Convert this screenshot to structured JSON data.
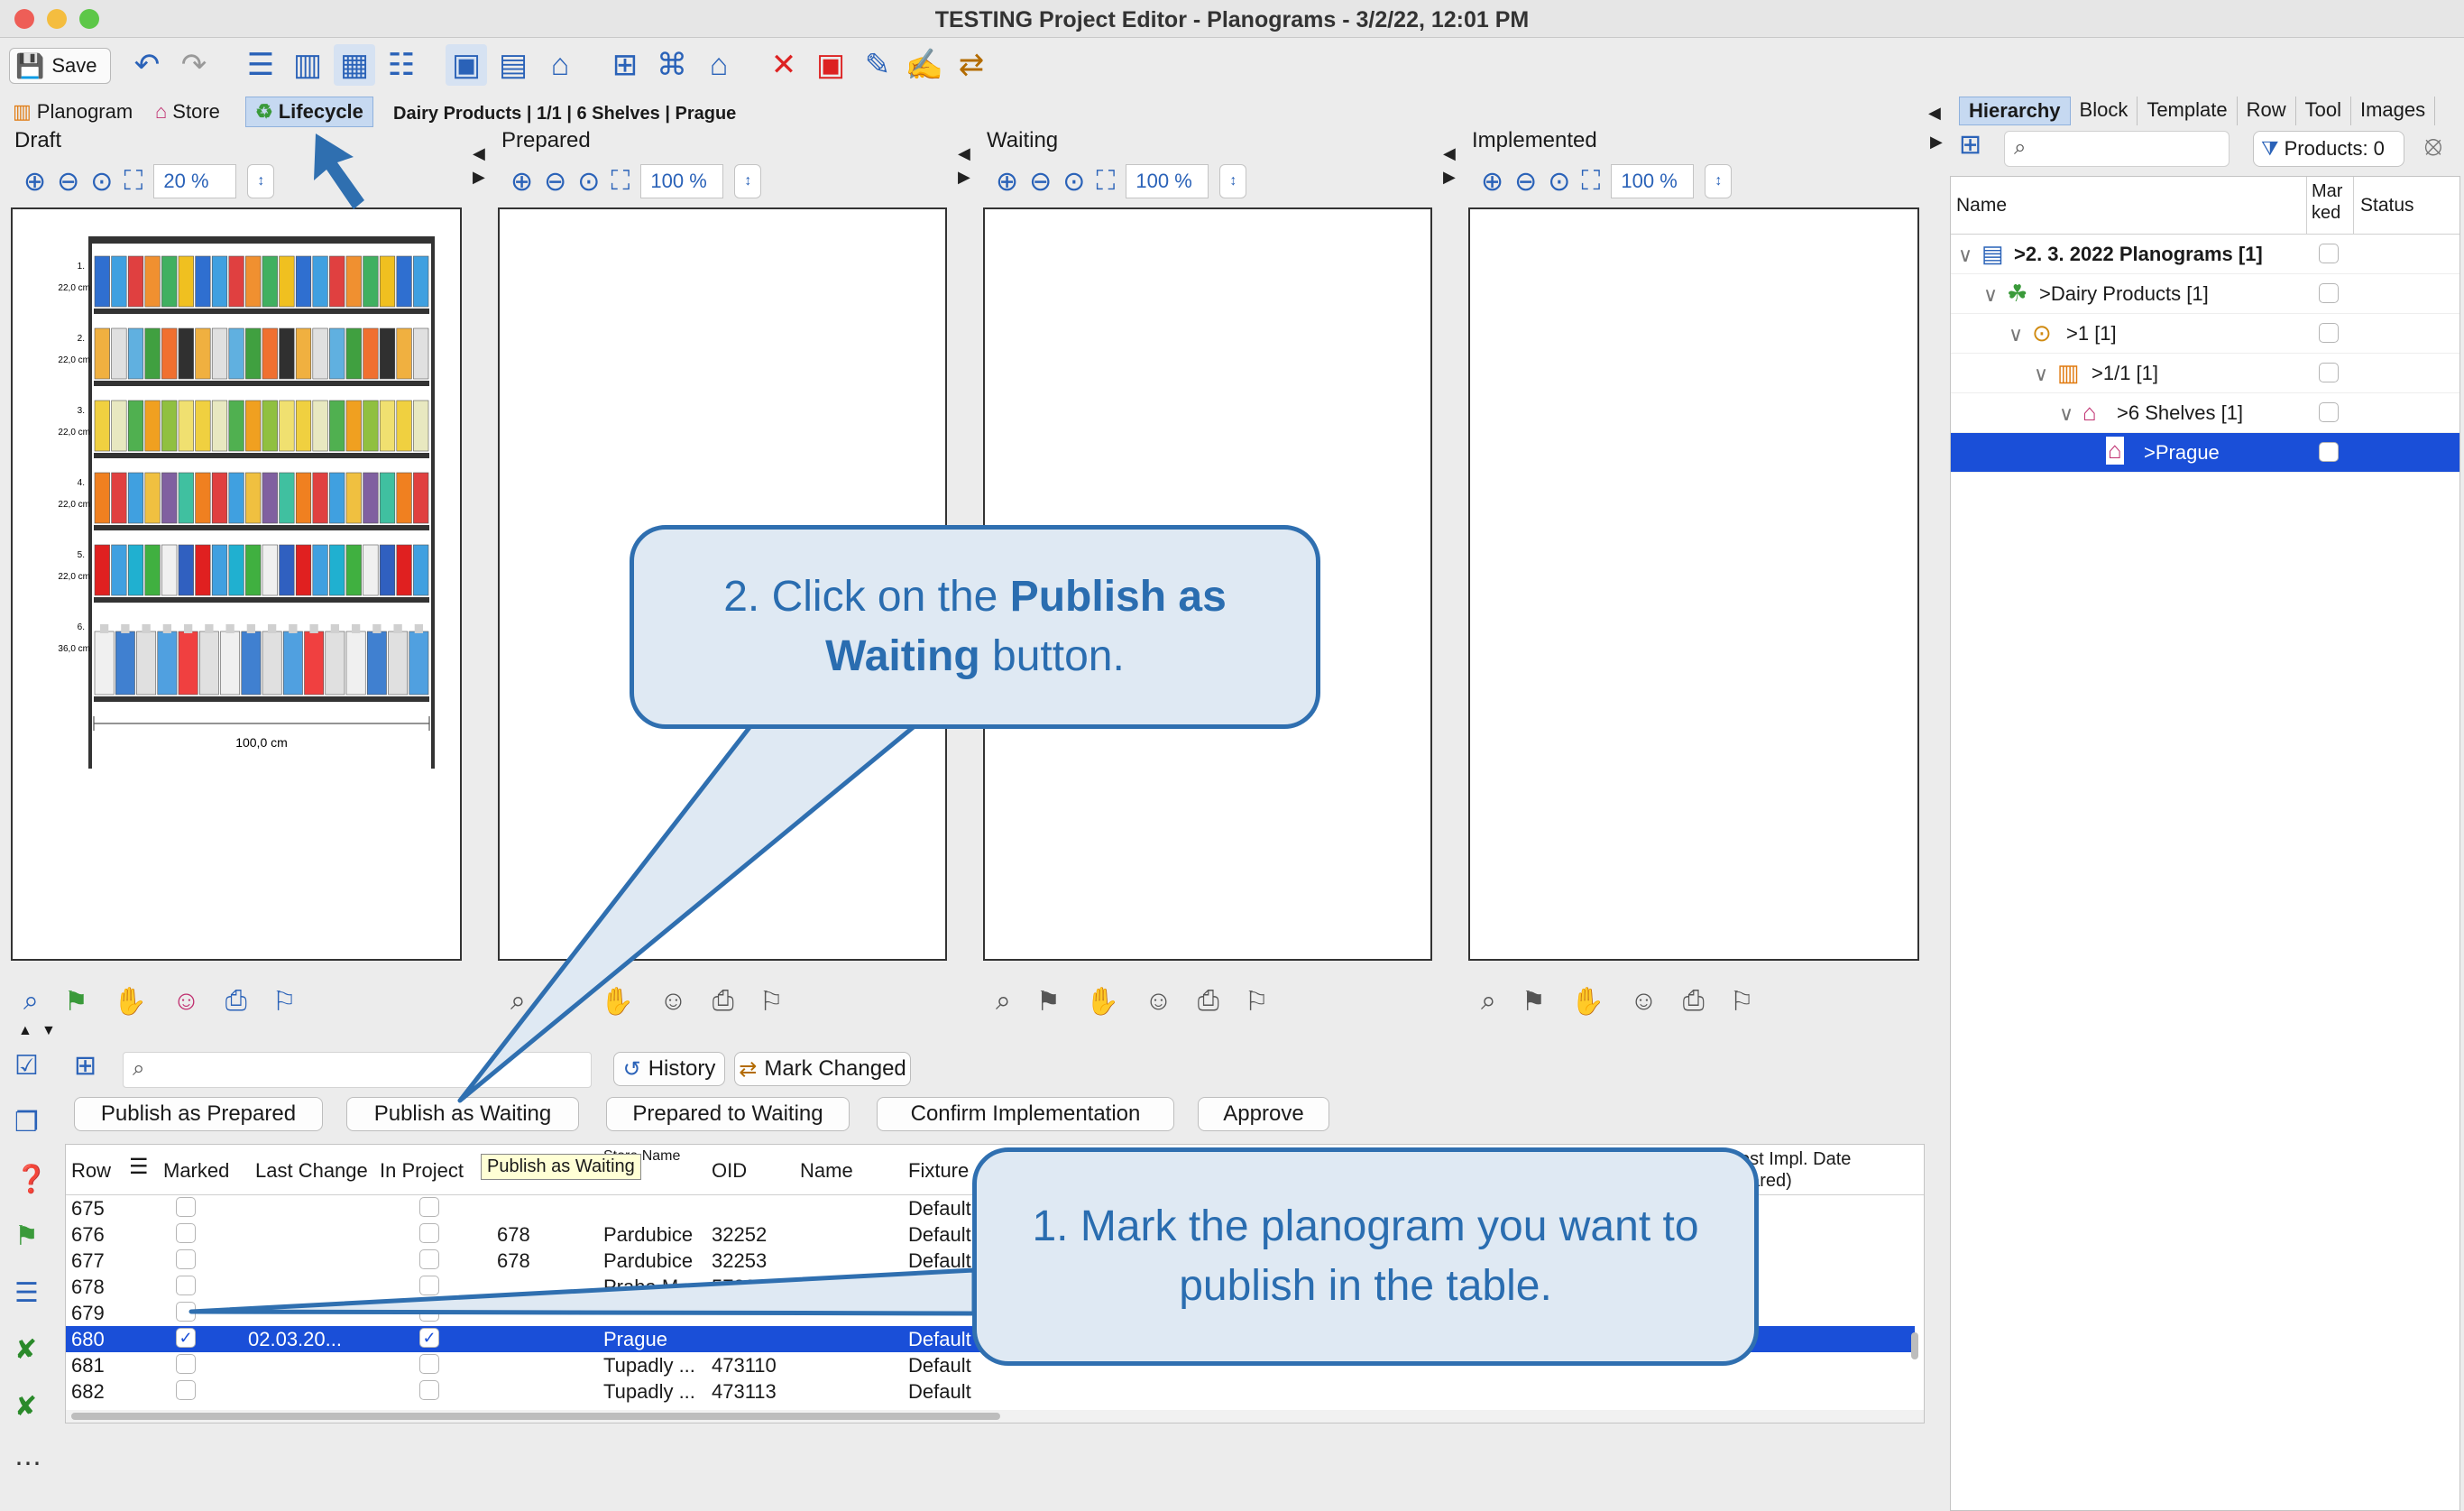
{
  "window": {
    "title": "TESTING Project Editor - Planograms - 3/2/22, 12:01 PM"
  },
  "toolbar": {
    "save_label": "Save"
  },
  "tabs": {
    "planogram": "Planogram",
    "store": "Store",
    "lifecycle": "Lifecycle",
    "breadcrumb": "Dairy Products | 1/1 | 6 Shelves | Prague"
  },
  "panes": [
    {
      "label": "Draft",
      "zoom": "20 %"
    },
    {
      "label": "Prepared",
      "zoom": "100 %"
    },
    {
      "label": "Waiting",
      "zoom": "100 %"
    },
    {
      "label": "Implemented",
      "zoom": "100 %"
    }
  ],
  "planogram": {
    "shelves": [
      {
        "num": "1.",
        "height": "22,0 cm"
      },
      {
        "num": "2.",
        "height": "22,0 cm"
      },
      {
        "num": "3.",
        "height": "22,0 cm"
      },
      {
        "num": "4.",
        "height": "22,0 cm"
      },
      {
        "num": "5.",
        "height": "22,0 cm"
      },
      {
        "num": "6.",
        "height": "36,0 cm"
      }
    ],
    "width_label": "100,0 cm"
  },
  "right_panel": {
    "tabs": [
      "Hierarchy",
      "Block",
      "Template",
      "Row",
      "Tool",
      "Images"
    ],
    "products_label": "Products: 0",
    "columns": {
      "name": "Name",
      "marked": "Mar\nked",
      "status": "Status"
    },
    "tree": [
      {
        "label": ">2. 3. 2022 Planograms [1]",
        "bold": true
      },
      {
        "label": ">Dairy Products [1]"
      },
      {
        "label": ">1 [1]"
      },
      {
        "label": ">1/1 [1]"
      },
      {
        "label": ">6 Shelves [1]"
      },
      {
        "label": ">Prague",
        "selected": true
      }
    ]
  },
  "bottom": {
    "history_label": "History",
    "mark_changed_label": "Mark Changed",
    "actions": {
      "publish_prepared": "Publish as Prepared",
      "publish_waiting": "Publish as Waiting",
      "prepared_to_waiting": "Prepared to Waiting",
      "confirm_impl": "Confirm Implementation",
      "approve": "Approve"
    },
    "columns": {
      "row": "Row",
      "marked": "Marked",
      "last_change": "Last Change",
      "in_project": "In Project",
      "store_name": "Store Name",
      "oid": "OID",
      "name": "Name",
      "fixture": "Fixture",
      "impl_date": "est Impl. Date pared)"
    },
    "tooltip": "Publish as Waiting",
    "rows": [
      {
        "row": "675",
        "marked": false,
        "last": "",
        "inproj": false,
        "a": "",
        "store": "",
        "oid": "",
        "fixture": "Default"
      },
      {
        "row": "676",
        "marked": false,
        "last": "",
        "inproj": false,
        "a": "678",
        "store": "Pardubice",
        "oid": "32252",
        "fixture": "Default"
      },
      {
        "row": "677",
        "marked": false,
        "last": "",
        "inproj": false,
        "a": "678",
        "store": "Pardubice",
        "oid": "32253",
        "fixture": "Default"
      },
      {
        "row": "678",
        "marked": false,
        "last": "",
        "inproj": false,
        "a": "",
        "store": "Praha M...",
        "oid": "578009",
        "fixture": "Default"
      },
      {
        "row": "679",
        "marked": false,
        "last": "",
        "inproj": false,
        "a": "",
        "store": "",
        "oid": "",
        "fixture": ""
      },
      {
        "row": "680",
        "marked": true,
        "last": "02.03.20...",
        "inproj": true,
        "a": "",
        "store": "Prague",
        "oid": "",
        "fixture": "Default",
        "selected": true
      },
      {
        "row": "681",
        "marked": false,
        "last": "",
        "inproj": false,
        "a": "",
        "store": "Tupadly ...",
        "oid": "473110",
        "fixture": "Default"
      },
      {
        "row": "682",
        "marked": false,
        "last": "",
        "inproj": false,
        "a": "",
        "store": "Tupadly ...",
        "oid": "473113",
        "fixture": "Default"
      }
    ]
  },
  "callouts": {
    "step2": "2. Click on the Publish as Waiting button.",
    "step2_a": "2. Click on the ",
    "step2_b": "Publish as",
    "step2_c": "Waiting",
    "step2_d": " button.",
    "step1_a": "1. Mark the planogram you want to",
    "step1_b": "publish in the table."
  },
  "colors": {
    "accent": "#2f6fb0",
    "callout_bg": "#dfe9f3",
    "selection": "#1a4fd8"
  }
}
